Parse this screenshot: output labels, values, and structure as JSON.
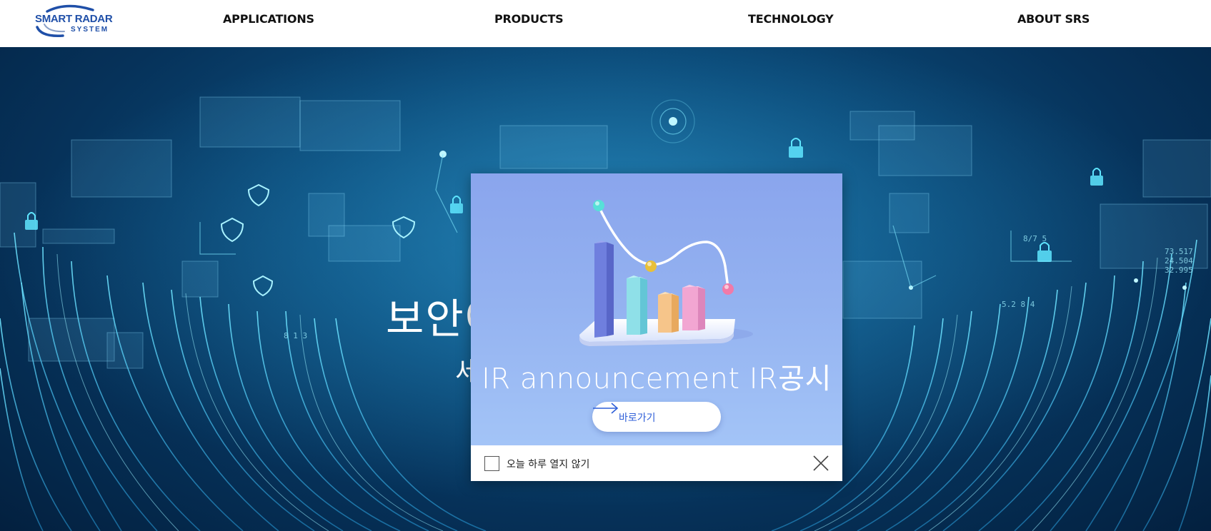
{
  "header": {
    "logo_main": "SMART RADAR",
    "logo_sub": "SYSTEM",
    "nav": [
      "APPLICATIONS",
      "PRODUCTS",
      "TECHNOLOGY",
      "ABOUT SRS"
    ]
  },
  "hero": {
    "title": "보안에 대한 새로운 이해",
    "subtitle": "세상을 연결하는 보안 기술"
  },
  "popup": {
    "title": "IR announcement IR공시",
    "button_label": "바로가기",
    "dont_show_label": "오늘 하루 열지 않기",
    "dont_show_checked": false
  },
  "colors": {
    "brand": "#1f4fa8",
    "popup_bg": "#93b1f0",
    "button_text": "#2f5fd8"
  },
  "icons": [
    "arrow-right-icon",
    "close-icon",
    "lock-icon",
    "shield-icon",
    "document-icon"
  ]
}
